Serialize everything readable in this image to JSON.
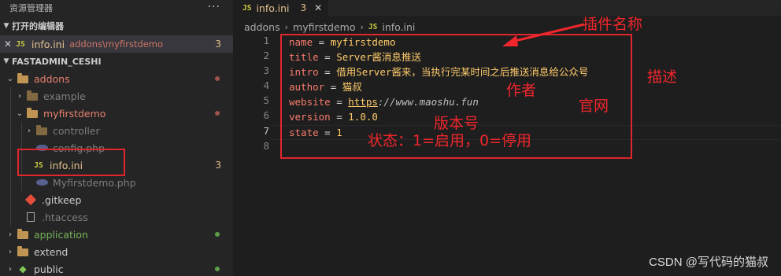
{
  "sidebar": {
    "title": "资源管理器",
    "more_icon": "more-horizontal-icon",
    "open_editors": {
      "header": "打开的编辑器",
      "items": [
        {
          "close_icon": "close-icon",
          "badge": "JS",
          "name": "info.ini",
          "path": "addons\\myfirstdemo",
          "problems": "3"
        }
      ]
    },
    "project": {
      "header": "FASTADMIN_CESHI",
      "tree": [
        {
          "name": "addons",
          "kind": "folder"
        },
        {
          "name": "example",
          "kind": "folder"
        },
        {
          "name": "myfirstdemo",
          "kind": "folder"
        },
        {
          "name": "controller",
          "kind": "folder"
        },
        {
          "name": "config.php",
          "kind": "php"
        },
        {
          "name": "info.ini",
          "kind": "js",
          "problems": "3"
        },
        {
          "name": "Myfirstdemo.php",
          "kind": "php"
        },
        {
          "name": ".gitkeep",
          "kind": "git"
        },
        {
          "name": ".htaccess",
          "kind": "file"
        },
        {
          "name": "application",
          "kind": "folder"
        },
        {
          "name": "extend",
          "kind": "folder"
        },
        {
          "name": "public",
          "kind": "public"
        }
      ]
    }
  },
  "tabs": [
    {
      "badge": "JS",
      "name": "info.ini",
      "problems": "3",
      "close_icon": "close-icon"
    }
  ],
  "breadcrumb": [
    "addons",
    "myfirstdemo",
    "info.ini"
  ],
  "editor": {
    "line_numbers": [
      "1",
      "2",
      "3",
      "4",
      "5",
      "6",
      "7",
      "8"
    ],
    "active_line": "7",
    "lines": [
      {
        "key": "name",
        "eq": " = ",
        "value": "myfirstdemo"
      },
      {
        "key": "title",
        "eq": " = ",
        "value": "Server酱消息推送"
      },
      {
        "key": "intro",
        "eq": " = ",
        "value": "借用Server酱来，当执行完某时间之后推送消息给公众号"
      },
      {
        "key": "author",
        "eq": " = ",
        "value": "猫叔"
      },
      {
        "key": "website",
        "eq": " = ",
        "value_prefix": "https",
        "value": "://www.maoshu.fun"
      },
      {
        "key": "version",
        "eq": " = ",
        "value": "1.0.0"
      },
      {
        "key": "state",
        "eq": " = ",
        "value": "1"
      },
      {
        "key": "",
        "eq": "",
        "value": ""
      }
    ]
  },
  "annotations": {
    "plugin_name": "插件名称",
    "description": "描述",
    "author": "作者",
    "website": "官网",
    "version": "版本号",
    "state": "状态：1=启用，0=停用",
    "color": "#f0262c"
  },
  "watermark": "CSDN @写代码的猫叔",
  "colors": {
    "accent_red": "#e0262c",
    "modified": "#e2c08d",
    "error": "#e7806e",
    "folder": "#c09553",
    "key": "#f87c6c",
    "value": "#ffcb6b"
  }
}
